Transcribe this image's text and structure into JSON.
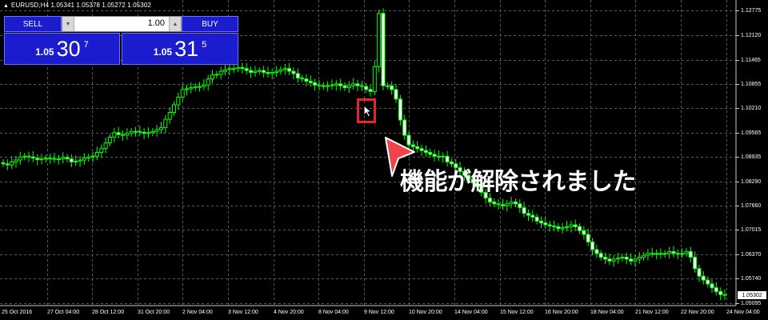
{
  "chart_title": "EURUSD,H4  1.05341 1.05378 1.05272 1.05302",
  "trade_panel": {
    "sell_label": "SELL",
    "buy_label": "BUY",
    "lot_value": "1.00",
    "sell_price": {
      "prefix": "1.05",
      "big": "30",
      "sup": "7"
    },
    "buy_price": {
      "prefix": "1.05",
      "big": "31",
      "sup": "5"
    }
  },
  "callout_text": "機能が解除されました",
  "price_axis": [
    "1.12775",
    "1.12120",
    "1.11465",
    "1.10855",
    "1.10210",
    "1.09565",
    "1.08935",
    "1.08290",
    "1.07660",
    "1.07015",
    "1.06370",
    "1.05740",
    "1.05095"
  ],
  "current_price_tag": "1.05302",
  "time_axis": [
    "25 Oct 2016",
    "27 Oct 04:00",
    "28 Oct 12:00",
    "31 Oct 20:00",
    "2 Nov 04:00",
    "3 Nov 12:00",
    "4 Nov 20:00",
    "8 Nov 04:00",
    "9 Nov 12:00",
    "10 Nov 20:00",
    "14 Nov 04:00",
    "15 Nov 12:00",
    "16 Nov 20:00",
    "18 Nov 04:00",
    "21 Nov 12:00",
    "22 Nov 20:00",
    "24 Nov 04:00"
  ],
  "colors": {
    "background": "#000000",
    "bull": "#00ff00",
    "grid": "#5a5a5a",
    "panel": "#1c1ccf",
    "highlight": "#e8232a"
  },
  "chart_data": {
    "type": "candlestick",
    "ylim": [
      1.0503,
      1.1305
    ],
    "close_series": [
      1.0875,
      1.0872,
      1.088,
      1.0885,
      1.0893,
      1.0895,
      1.0893,
      1.089,
      1.0886,
      1.0888,
      1.089,
      1.0889,
      1.0888,
      1.0888,
      1.0892,
      1.0888,
      1.088,
      1.0882,
      1.0885,
      1.089,
      1.0893,
      1.0895,
      1.0905,
      1.0915,
      1.093,
      1.0945,
      1.0957,
      1.0952,
      1.095,
      1.0955,
      1.096,
      1.096,
      1.0958,
      1.0955,
      1.0957,
      1.096,
      1.0965,
      1.097,
      1.0992,
      1.101,
      1.103,
      1.105,
      1.107,
      1.1072,
      1.1075,
      1.1078,
      1.1078,
      1.1082,
      1.1098,
      1.1108,
      1.111,
      1.1118,
      1.1122,
      1.1125,
      1.1125,
      1.1128,
      1.1125,
      1.112,
      1.1115,
      1.1118,
      1.112,
      1.1115,
      1.1112,
      1.1115,
      1.1118,
      1.1122,
      1.1125,
      1.1118,
      1.1112,
      1.11,
      1.1098,
      1.1092,
      1.1088,
      1.1082,
      1.108,
      1.1078,
      1.108,
      1.1082,
      1.1085,
      1.108,
      1.1075,
      1.108,
      1.1085,
      1.108,
      1.1078,
      1.107,
      1.1065,
      1.113,
      1.127,
      1.108,
      1.108,
      1.107,
      1.1045,
      1.099,
      1.095,
      1.0925,
      1.092,
      1.0915,
      1.091,
      1.0905,
      1.09,
      1.0895,
      1.0893,
      1.0895,
      1.088,
      1.0875,
      1.0865,
      1.0855,
      1.0845,
      1.0835,
      1.0825,
      1.0815,
      1.08,
      1.0785,
      1.0775,
      1.077,
      1.0768,
      1.0765,
      1.077,
      1.0775,
      1.077,
      1.076,
      1.0745,
      1.074,
      1.0735,
      1.0725,
      1.072,
      1.0715,
      1.0712,
      1.071,
      1.0705,
      1.0708,
      1.071,
      1.0715,
      1.071,
      1.07,
      1.069,
      1.067,
      1.065,
      1.064,
      1.063,
      1.0625,
      1.062,
      1.0625,
      1.0628,
      1.063,
      1.0625,
      1.062,
      1.0625,
      1.063,
      1.0635,
      1.064,
      1.064,
      1.064,
      1.0638,
      1.064,
      1.0645,
      1.064,
      1.064,
      1.064,
      1.0645,
      1.063,
      1.06,
      1.058,
      1.057,
      1.056,
      1.055,
      1.054,
      1.0532,
      1.053
    ]
  }
}
